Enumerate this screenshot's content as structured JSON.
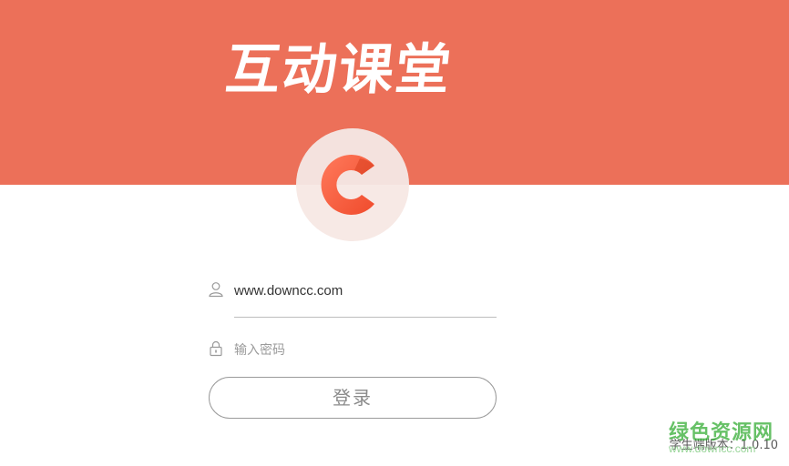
{
  "app": {
    "title": "互动课堂",
    "brand_color": "#ec7059",
    "logo_icon": "c-logo-icon"
  },
  "login": {
    "username_value": "www.downcc.com",
    "username_icon": "user-icon",
    "password_placeholder": "输入密码",
    "password_icon": "lock-icon",
    "submit_label": "登录"
  },
  "footer": {
    "version_label": "学生端版本：",
    "version_number": "1.0.10"
  },
  "watermark": {
    "text": "绿色资源网",
    "url": "www.downcc.com"
  }
}
